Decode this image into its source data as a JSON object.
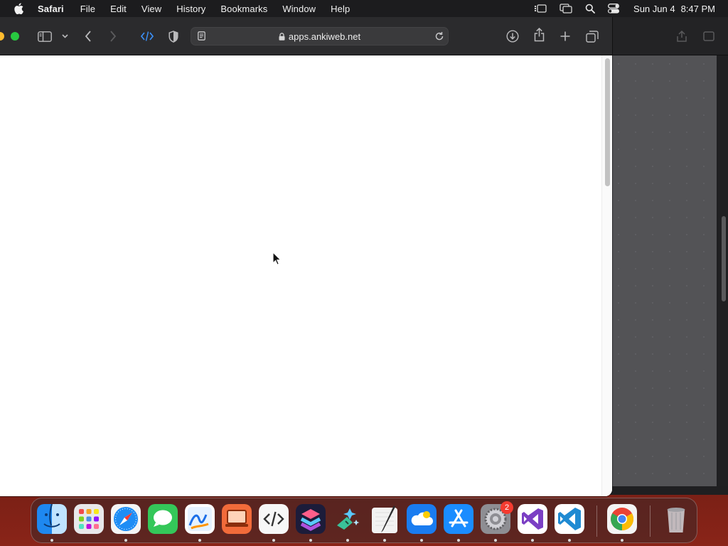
{
  "menubar": {
    "app_name": "Safari",
    "items": [
      "File",
      "Edit",
      "View",
      "History",
      "Bookmarks",
      "Window",
      "Help"
    ],
    "status_icons": [
      "stage-manager-icon",
      "screen-mirroring-icon",
      "spotlight-icon",
      "control-center-icon"
    ],
    "date": "Sun Jun 4",
    "time": "8:47 PM"
  },
  "safari": {
    "url": "apps.ankiweb.net",
    "toolbar_icons": [
      "sidebar-icon",
      "chevron-down-icon",
      "back-icon",
      "forward-icon",
      "develop-icon",
      "privacy-shield-icon",
      "reader-icon",
      "lock-icon",
      "reload-icon",
      "downloads-icon",
      "share-icon",
      "new-tab-icon",
      "tab-overview-icon"
    ],
    "colors": {
      "traffic_yellow": "#febc2e",
      "traffic_green": "#28c840",
      "accent_blue": "#3b8ff6"
    }
  },
  "dock": {
    "apps": [
      {
        "name": "Finder",
        "icon": "finder-icon"
      },
      {
        "name": "Launchpad",
        "icon": "launchpad-icon"
      },
      {
        "name": "Safari",
        "icon": "safari-icon"
      },
      {
        "name": "Messages",
        "icon": "messages-icon"
      },
      {
        "name": "Freeform",
        "icon": "freeform-icon"
      },
      {
        "name": "Screen Sharing",
        "icon": "screen-sharing-icon"
      },
      {
        "name": "Script Editor",
        "icon": "script-editor-icon"
      },
      {
        "name": "Shortcuts",
        "icon": "shortcuts-icon"
      },
      {
        "name": "Cleaner",
        "icon": "cleaner-icon"
      },
      {
        "name": "Script Editor Pen",
        "icon": "pen-app-icon"
      },
      {
        "name": "iCloud Drive",
        "icon": "icloud-icon"
      },
      {
        "name": "App Store",
        "icon": "app-store-icon"
      },
      {
        "name": "System Settings",
        "icon": "system-settings-icon"
      },
      {
        "name": "Visual Studio",
        "icon": "visual-studio-icon"
      },
      {
        "name": "VS Code",
        "icon": "vscode-icon"
      },
      {
        "name": "Google Chrome",
        "icon": "chrome-icon"
      },
      {
        "name": "Trash",
        "icon": "trash-icon"
      }
    ],
    "settings_badge": "2"
  }
}
